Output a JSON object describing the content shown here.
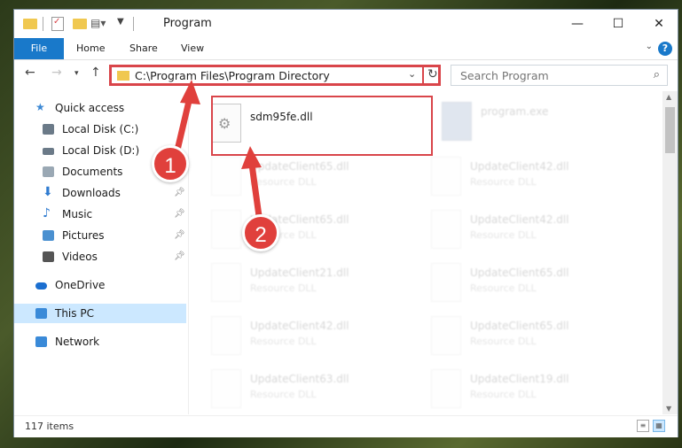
{
  "window": {
    "title": "Program"
  },
  "ribbon": {
    "tabs": [
      "File",
      "Home",
      "Share",
      "View"
    ],
    "help": "?"
  },
  "nav": {
    "address": "C:\\Program Files\\Program Directory",
    "search_placeholder": "Search Program"
  },
  "sidebar": {
    "items": [
      {
        "label": "Quick access",
        "icon": "star-icon",
        "color": "#3c88d4"
      },
      {
        "label": "Local Disk (C:)",
        "icon": "drive-icon",
        "color": "#6b7a88"
      },
      {
        "label": "Local Disk (D:)",
        "icon": "drive-icon",
        "color": "#6b7a88"
      },
      {
        "label": "Documents",
        "icon": "documents-icon",
        "color": "#9aa8b4"
      },
      {
        "label": "Downloads",
        "icon": "download-icon",
        "color": "#2f7bd0"
      },
      {
        "label": "Music",
        "icon": "music-icon",
        "color": "#2f7bd0"
      },
      {
        "label": "Pictures",
        "icon": "pictures-icon",
        "color": "#4a90d0"
      },
      {
        "label": "Videos",
        "icon": "videos-icon",
        "color": "#555"
      },
      {
        "label": "OneDrive",
        "icon": "cloud-icon",
        "color": "#1b6fd0"
      },
      {
        "label": "This PC",
        "icon": "computer-icon",
        "color": "#3a8ad8"
      },
      {
        "label": "Network",
        "icon": "network-icon",
        "color": "#3a8ad8"
      }
    ]
  },
  "files": {
    "main": {
      "name": "sdm95fe.dll"
    },
    "program": {
      "name": "program.exe"
    },
    "left": [
      {
        "name": "UpdateClient65.dll",
        "type": "Resource DLL"
      },
      {
        "name": "UpdateClient65.dll",
        "type": "Resource DLL"
      },
      {
        "name": "UpdateClient21.dll",
        "type": "Resource DLL"
      },
      {
        "name": "UpdateClient42.dll",
        "type": "Resource DLL"
      },
      {
        "name": "UpdateClient63.dll",
        "type": "Resource DLL"
      }
    ],
    "right": [
      {
        "name": "UpdateClient42.dll",
        "type": "Resource DLL"
      },
      {
        "name": "UpdateClient42.dll",
        "type": "Resource DLL"
      },
      {
        "name": "UpdateClient65.dll",
        "type": "Resource DLL"
      },
      {
        "name": "UpdateClient65.dll",
        "type": "Resource DLL"
      },
      {
        "name": "UpdateClient19.dll",
        "type": "Resource DLL"
      }
    ]
  },
  "status": {
    "items": "117 items"
  },
  "annotations": {
    "step1": "1",
    "step2": "2",
    "color": "#e0403c"
  }
}
